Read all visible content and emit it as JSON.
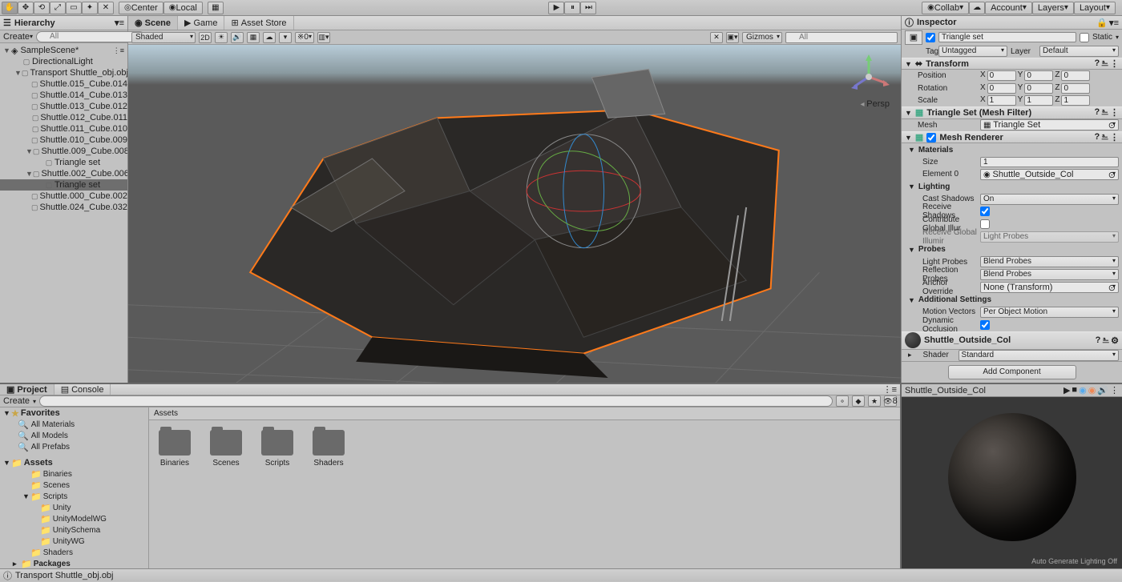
{
  "toolbar": {
    "pivot": "Center",
    "handle": "Local",
    "collab": "Collab",
    "account": "Account",
    "layers": "Layers",
    "layout": "Layout"
  },
  "hierarchy": {
    "title": "Hierarchy",
    "create": "Create",
    "search_placeholder": "All",
    "scene": "SampleScene*",
    "items": [
      {
        "name": "DirectionalLight",
        "depth": 1
      },
      {
        "name": "Transport Shuttle_obj.obj",
        "depth": 1,
        "arrow": "▼"
      },
      {
        "name": "Shuttle.015_Cube.014",
        "depth": 2
      },
      {
        "name": "Shuttle.014_Cube.013",
        "depth": 2
      },
      {
        "name": "Shuttle.013_Cube.012",
        "depth": 2
      },
      {
        "name": "Shuttle.012_Cube.011",
        "depth": 2
      },
      {
        "name": "Shuttle.011_Cube.010",
        "depth": 2
      },
      {
        "name": "Shuttle.010_Cube.009",
        "depth": 2
      },
      {
        "name": "Shuttle.009_Cube.008",
        "depth": 2,
        "arrow": "▼"
      },
      {
        "name": "Triangle set",
        "depth": 3
      },
      {
        "name": "Shuttle.002_Cube.006",
        "depth": 2,
        "arrow": "▼"
      },
      {
        "name": "Triangle set",
        "depth": 3,
        "selected": true
      },
      {
        "name": "Shuttle.000_Cube.002",
        "depth": 2
      },
      {
        "name": "Shuttle.024_Cube.032",
        "depth": 2
      }
    ]
  },
  "scene": {
    "tabs": [
      "Scene",
      "Game",
      "Asset Store"
    ],
    "shading": "Shaded",
    "mode2d": "2D",
    "gizmos": "Gizmos",
    "search_placeholder": "All",
    "persp": "Persp"
  },
  "inspector": {
    "title": "Inspector",
    "object_name": "Triangle set",
    "static": "Static",
    "tag_label": "Tag",
    "tag": "Untagged",
    "layer_label": "Layer",
    "layer": "Default",
    "transform": {
      "title": "Transform",
      "position": "Position",
      "rotation": "Rotation",
      "scale": "Scale",
      "px": "0",
      "py": "0",
      "pz": "0",
      "rx": "0",
      "ry": "0",
      "rz": "0",
      "sx": "1",
      "sy": "1",
      "sz": "1"
    },
    "meshfilter": {
      "title": "Triangle Set (Mesh Filter)",
      "mesh_label": "Mesh",
      "mesh": "Triangle Set"
    },
    "renderer": {
      "title": "Mesh Renderer",
      "materials": "Materials",
      "size_label": "Size",
      "size": "1",
      "element0_label": "Element 0",
      "element0": "Shuttle_Outside_Col",
      "lighting": "Lighting",
      "cast_shadows_label": "Cast Shadows",
      "cast_shadows": "On",
      "receive_shadows": "Receive Shadows",
      "contribute_gi": "Contribute Global Illur",
      "receive_gi_label": "Receive Global Illumir",
      "receive_gi": "Light Probes",
      "probes": "Probes",
      "light_probes_label": "Light Probes",
      "light_probes": "Blend Probes",
      "reflection_label": "Reflection Probes",
      "reflection": "Blend Probes",
      "anchor_label": "Anchor Override",
      "anchor": "None (Transform)",
      "additional": "Additional Settings",
      "motion_label": "Motion Vectors",
      "motion": "Per Object Motion",
      "dynocc": "Dynamic Occlusion"
    },
    "material": {
      "name": "Shuttle_Outside_Col",
      "shader_label": "Shader",
      "shader": "Standard"
    },
    "add_component": "Add Component"
  },
  "project": {
    "tabs": [
      "Project",
      "Console"
    ],
    "create": "Create",
    "search_placeholder": "",
    "count": "8",
    "favorites": "Favorites",
    "fav_items": [
      "All Materials",
      "All Models",
      "All Prefabs"
    ],
    "assets": "Assets",
    "asset_tree": [
      {
        "name": "Binaries",
        "depth": 1
      },
      {
        "name": "Scenes",
        "depth": 1
      },
      {
        "name": "Scripts",
        "depth": 1,
        "arrow": "▼"
      },
      {
        "name": "Unity",
        "depth": 2
      },
      {
        "name": "UnityModelWG",
        "depth": 2
      },
      {
        "name": "UnitySchema",
        "depth": 2
      },
      {
        "name": "UnityWG",
        "depth": 2
      },
      {
        "name": "Shaders",
        "depth": 1
      },
      {
        "name": "Packages",
        "depth": 0,
        "bold": true,
        "arrow": "▸"
      }
    ],
    "breadcrumb": "Assets",
    "folders": [
      "Binaries",
      "Scenes",
      "Scripts",
      "Shaders"
    ]
  },
  "preview": {
    "name": "Shuttle_Outside_Col",
    "footer": "Auto Generate Lighting Off"
  },
  "status": "Transport Shuttle_obj.obj"
}
